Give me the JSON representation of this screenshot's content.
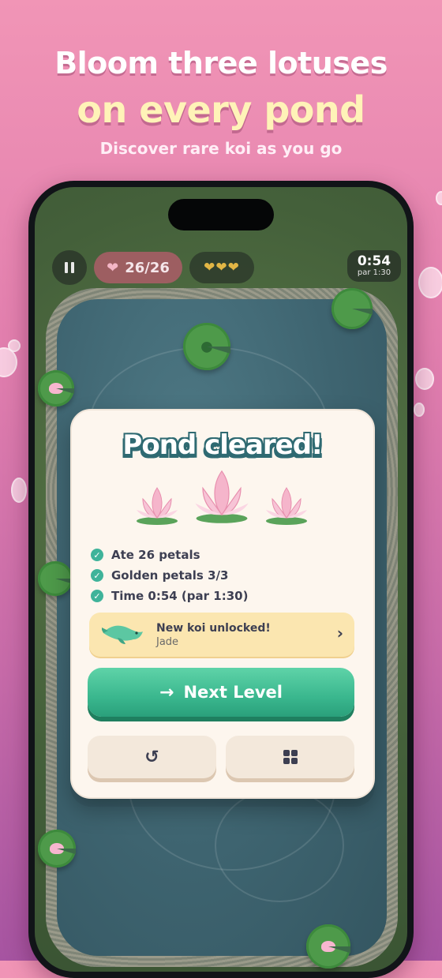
{
  "promo": {
    "headline_line1": "Bloom three lotuses",
    "headline_line2": "on every pond",
    "tagline": "Discover rare koi as you go"
  },
  "hud": {
    "petal_counter": "26/26",
    "golden_hearts": "💛💛💛",
    "timer": "0:54",
    "timer_par": "par 1:30",
    "pause_icon": "pause-icon",
    "heart_icon": "heart-icon"
  },
  "result": {
    "title": "Pond cleared!",
    "lotus_count": 3,
    "stats": [
      {
        "text": "Ate 26 petals"
      },
      {
        "text": "Golden petals 3/3"
      },
      {
        "text": "Time 0:54 (par 1:30)"
      }
    ],
    "koi": {
      "title": "New koi unlocked!",
      "name": "Jade"
    },
    "next_label": "Next Level",
    "replay_icon": "replay-icon",
    "levels_icon": "grid-icon"
  },
  "colors": {
    "accent_green": "#3ab78e",
    "title_outline": "#2f6a72",
    "banner": "#fbe6b0"
  }
}
